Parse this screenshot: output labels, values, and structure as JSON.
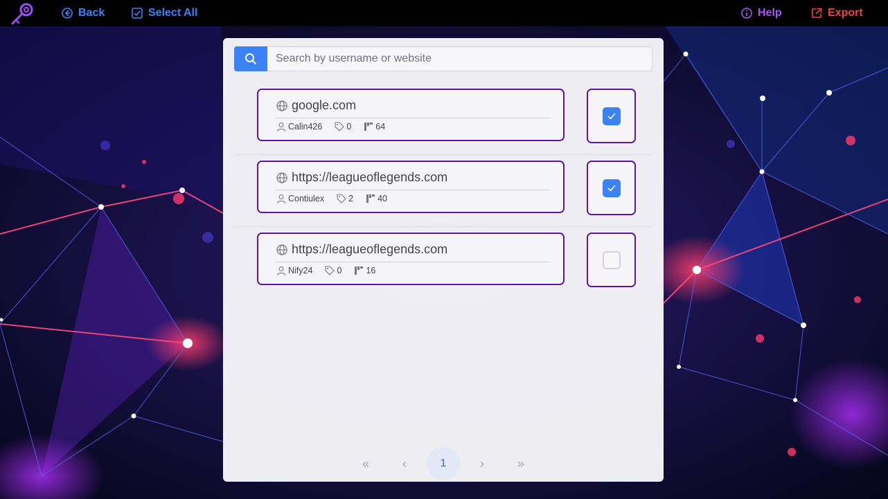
{
  "toolbar": {
    "back_label": "Back",
    "select_all_label": "Select All",
    "help_label": "Help",
    "export_label": "Export"
  },
  "search": {
    "placeholder": "Search by username or website",
    "value": ""
  },
  "entries": [
    {
      "website": "google.com",
      "username": "Calin426",
      "tags": "0",
      "strength": "64",
      "selected": true
    },
    {
      "website": "https://leagueoflegends.com",
      "username": "Contiulex",
      "tags": "2",
      "strength": "40",
      "selected": true
    },
    {
      "website": "https://leagueoflegends.com",
      "username": "Nify24",
      "tags": "0",
      "strength": "16",
      "selected": false
    }
  ],
  "pagination": {
    "first": "«",
    "prev": "‹",
    "current": "1",
    "next": "›",
    "last": "»"
  },
  "colors": {
    "accent": "#3b82f6",
    "border": "#5b18a8",
    "help": "#a855f7",
    "export": "#ef4444"
  }
}
